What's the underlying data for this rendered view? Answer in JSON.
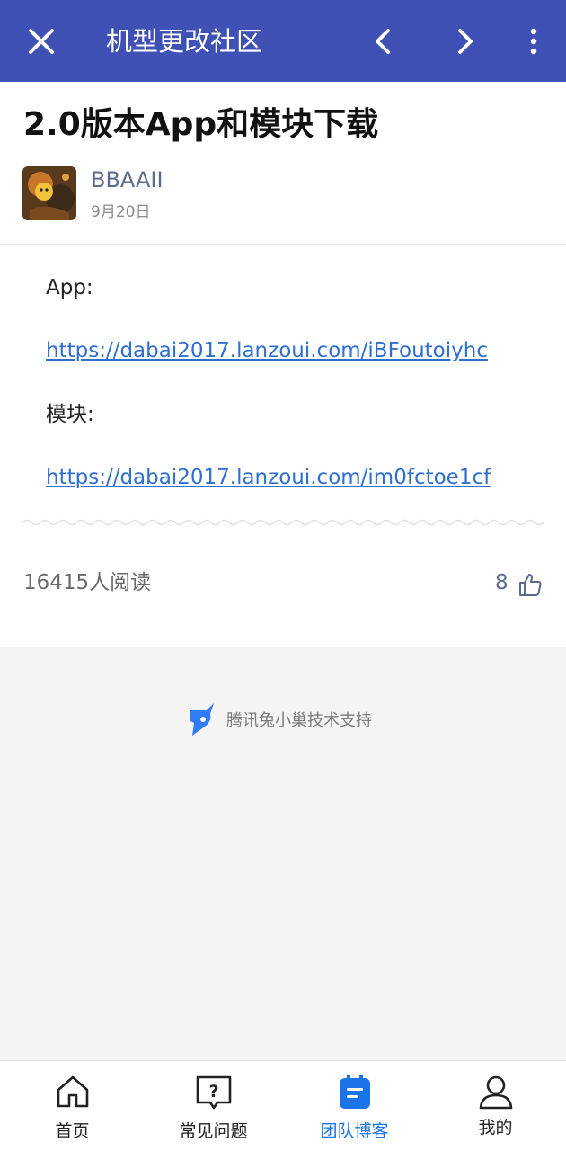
{
  "topbar": {
    "title": "机型更改社区"
  },
  "post": {
    "title": "2.0版本App和模块下载",
    "author": "BBAAII",
    "date": "9月20日",
    "app_label": "App:",
    "app_link": "https://dabai2017.lanzoui.com/iBFoutoiyhc",
    "module_label": "模块:",
    "module_link": "https://dabai2017.lanzoui.com/im0fctoe1cf",
    "reads": "16415人阅读",
    "likes": "8"
  },
  "footer": {
    "support": "腾讯兔小巢技术支持"
  },
  "tabs": [
    {
      "label": "首页",
      "icon": "home-icon"
    },
    {
      "label": "常见问题",
      "icon": "faq-icon"
    },
    {
      "label": "团队博客",
      "icon": "blog-icon",
      "active": true
    },
    {
      "label": "我的",
      "icon": "user-icon"
    }
  ],
  "colors": {
    "brand": "#3f51b5",
    "link": "#2f6fd0",
    "active_tab": "#1a73e8"
  }
}
